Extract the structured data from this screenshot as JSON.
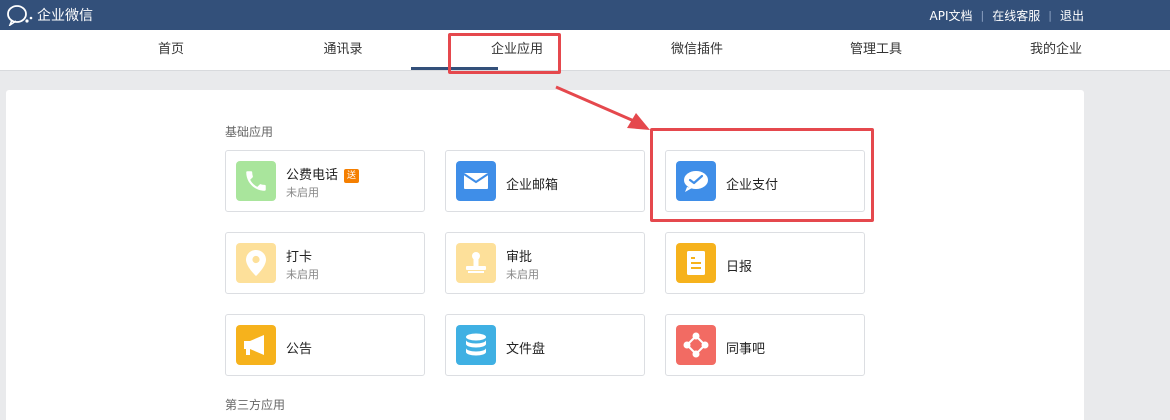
{
  "header": {
    "logo_text": "企业微信",
    "links": [
      "API文档",
      "在线客服",
      "退出"
    ],
    "separator": "|"
  },
  "nav": {
    "items": [
      "首页",
      "通讯录",
      "企业应用",
      "微信插件",
      "管理工具",
      "我的企业"
    ],
    "active": "企业应用"
  },
  "sections": {
    "basic": "基础应用",
    "third_party": "第三方应用"
  },
  "apps": [
    {
      "name": "公费电话",
      "status": "未启用",
      "badge": "送",
      "icon": "phone-icon",
      "color": "#a9e59c"
    },
    {
      "name": "企业邮箱",
      "icon": "mail-icon",
      "color": "#3f8ee8"
    },
    {
      "name": "企业支付",
      "icon": "pay-icon",
      "color": "#3f8ee8"
    },
    {
      "name": "打卡",
      "status": "未启用",
      "icon": "location-pin-icon",
      "color": "#fde09a"
    },
    {
      "name": "审批",
      "status": "未启用",
      "icon": "stamp-icon",
      "color": "#fde09a"
    },
    {
      "name": "日报",
      "icon": "report-icon",
      "color": "#f6b21c"
    },
    {
      "name": "公告",
      "icon": "megaphone-icon",
      "color": "#f6b21c"
    },
    {
      "name": "文件盘",
      "icon": "disk-icon",
      "color": "#3fb0e3"
    },
    {
      "name": "同事吧",
      "icon": "colleague-network-icon",
      "color": "#f26b63"
    }
  ],
  "colors": {
    "header_bg": "#33507a",
    "annotation": "#e5484d",
    "badge": "#f57f00"
  }
}
